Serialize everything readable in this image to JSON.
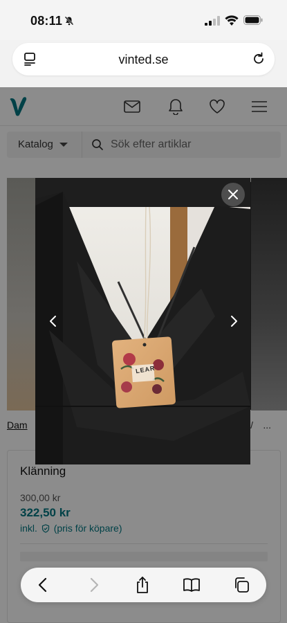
{
  "status_bar": {
    "time": "08:11"
  },
  "browser": {
    "url": "vinted.se"
  },
  "site": {
    "logo_letter": "V",
    "catalog_label": "Katalog",
    "search_placeholder": "Sök efter artiklar"
  },
  "breadcrumb": {
    "first": "Dam",
    "slash": "/",
    "more": "..."
  },
  "item": {
    "title": "Klänning",
    "price": "300,00 kr",
    "total_price": "322,50 kr",
    "fee_prefix": "inkl.",
    "fee_suffix": "(pris för köpare)"
  },
  "lightbox": {
    "tag_brand": "LEAR"
  },
  "colors": {
    "brand": "#007782",
    "accent": "#007782"
  }
}
